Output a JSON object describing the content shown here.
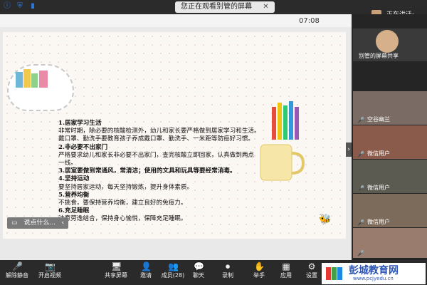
{
  "topbar": {
    "viewing": "您正在观看别管的屏幕",
    "close_glyph": "✕",
    "speaking": "正在讲话:"
  },
  "toolbar": {
    "time": "07:08"
  },
  "slide": {
    "sections": [
      {
        "title": "1.居家学习生活",
        "lines": [
          "非常时期，除必要的核酸检测外，幼儿和家长要严格做到居家学习和生活。",
          "戴口罩、勤洗手要教育孩子养成戴口罩、勤洗手、一米距等防疫好习惯。"
        ]
      },
      {
        "title": "2.非必要不出家门",
        "lines": [
          "严格要求幼儿和家长非必要不出家门，查完核酸立即回家，认真做到两点",
          "一线。"
        ]
      },
      {
        "title": "3.居室要做到常通风，常清洁；使用的文具和玩具等要经常消毒。",
        "lines": []
      },
      {
        "title": "4.坚持运动",
        "lines": [
          "要坚持居家运动，每天坚持锻炼，提升身体素质。"
        ]
      },
      {
        "title": "5.营养均衡",
        "lines": [
          "不挑食，要保持营养均衡，建立良好的免疫力。"
        ]
      },
      {
        "title": "6.充足睡眠",
        "lines": [
          "注意劳逸结合，保持身心愉悦，保障充足睡眠。"
        ]
      }
    ]
  },
  "say_input": {
    "placeholder": "说点什么...",
    "chevron": "‹"
  },
  "sidebar": {
    "host_name": "别管的屏幕共享",
    "tiles": [
      {
        "name": "空谷幽兰",
        "color": "#7a6c64"
      },
      {
        "name": "微信用户",
        "color": "#8a5a4a"
      },
      {
        "name": "微信用户",
        "color": "#5b5b52"
      },
      {
        "name": "微信用户",
        "color": "#7c6b5a"
      },
      {
        "name": "",
        "color": "#9a7c6e"
      },
      {
        "name": "",
        "color": "#6d6d6d"
      }
    ]
  },
  "bottom": {
    "buttons": [
      {
        "label": "解除静音",
        "icon": "🎤"
      },
      {
        "label": "开启视频",
        "icon": "📷"
      },
      {
        "label": "共享屏幕",
        "icon": "🖥"
      },
      {
        "label": "邀请",
        "icon": "👤"
      },
      {
        "label": "成员(28)",
        "icon": "👥"
      },
      {
        "label": "聊天",
        "icon": "💬"
      },
      {
        "label": "录制",
        "icon": "⏺"
      },
      {
        "label": "举手",
        "icon": "✋"
      },
      {
        "label": "应用",
        "icon": "▦"
      },
      {
        "label": "设置",
        "icon": "⚙"
      }
    ],
    "logo_text": "彭城教育网",
    "logo_url": "www.pcjyedu.cn"
  }
}
